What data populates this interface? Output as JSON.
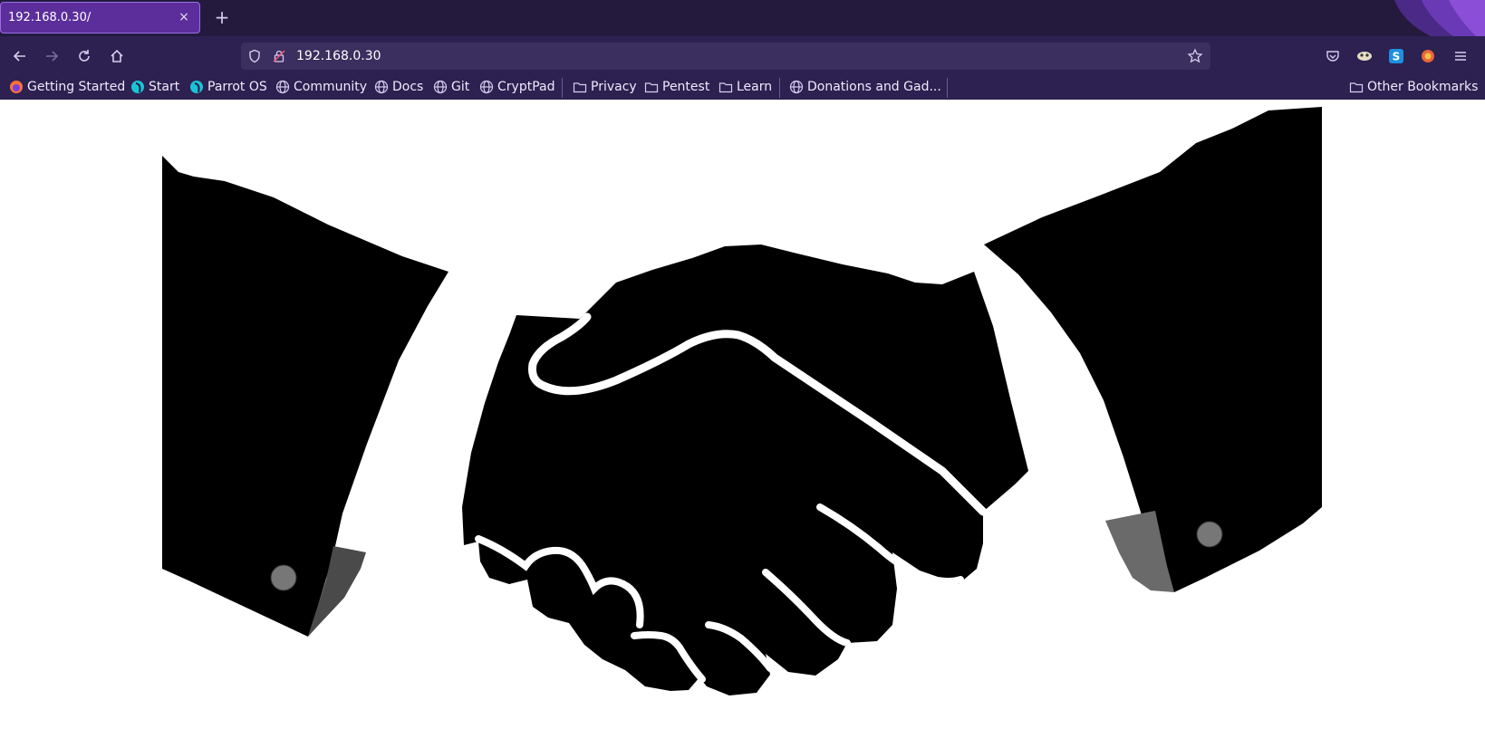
{
  "tab": {
    "title": "192.168.0.30/",
    "close": "×",
    "new_tab": "+"
  },
  "nav": {
    "url": "192.168.0.30"
  },
  "bookmarks": {
    "items": [
      {
        "label": "Getting Started"
      },
      {
        "label": "Start"
      },
      {
        "label": "Parrot OS"
      },
      {
        "label": "Community"
      },
      {
        "label": "Docs"
      },
      {
        "label": "Git"
      },
      {
        "label": "CryptPad"
      },
      {
        "label": "Privacy"
      },
      {
        "label": "Pentest"
      },
      {
        "label": "Learn"
      },
      {
        "label": "Donations and Gad..."
      },
      {
        "label": "Other Bookmarks"
      }
    ]
  },
  "icons": [
    "back-icon",
    "forward-icon",
    "reload-icon",
    "home-icon",
    "shield-icon",
    "lock-icon",
    "star-icon",
    "pocket-icon",
    "extension-icon",
    "s-extension-icon",
    "container-icon",
    "menu-icon",
    "handshake-image"
  ],
  "colors": {
    "tabbar": "#231a3e",
    "toolbar": "#2c2150",
    "active_tab": "#5b2e9c",
    "urlbar": "#3a2f5e"
  }
}
